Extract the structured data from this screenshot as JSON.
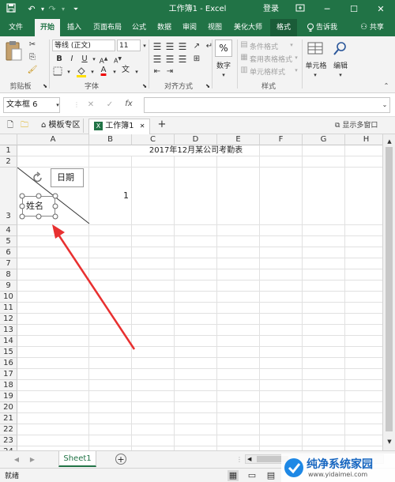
{
  "window": {
    "title": "工作簿1 - Excel",
    "login": "登录"
  },
  "tabs": [
    "文件",
    "开始",
    "插入",
    "页面布局",
    "公式",
    "数据",
    "审阅",
    "视图",
    "美化大师",
    "格式"
  ],
  "tell_me": "告诉我",
  "share": "共享",
  "ribbon": {
    "clipboard_label": "剪贴板",
    "font_label": "字体",
    "align_label": "对齐方式",
    "styles_label": "样式",
    "font_name": "等线 (正文)",
    "font_size": "11",
    "number_label": "数字",
    "percent": "%",
    "cond_format": "条件格式",
    "table_format": "套用表格格式",
    "cell_styles": "单元格样式",
    "cells": "单元格",
    "editing": "编辑",
    "bold": "B",
    "italic": "I",
    "underline": "U",
    "font_color_letter": "A",
    "wen": "文"
  },
  "formula_bar": {
    "name_box": "文本框 6",
    "fx": "fx",
    "cancel": "✕",
    "confirm": "✓",
    "value": ""
  },
  "workbook_tabs": {
    "tab1": "模板专区",
    "tab2": "工作簿1",
    "add": "+",
    "show_multi": "显示多窗口"
  },
  "grid": {
    "columns": [
      "A",
      "B",
      "C",
      "D",
      "E",
      "F",
      "G",
      "H"
    ],
    "rows": [
      "1",
      "2",
      "3",
      "4",
      "5",
      "6",
      "7",
      "8",
      "9",
      "10",
      "11",
      "12",
      "13",
      "14",
      "15",
      "16",
      "17",
      "18",
      "19",
      "20",
      "21",
      "22",
      "23",
      "24"
    ],
    "title_text": "2017年12月某公司考勤表",
    "date_label": "日期",
    "name_label": "姓名",
    "b3_value": "1"
  },
  "sheet_tabs": {
    "sheet1": "Sheet1",
    "add": "+"
  },
  "status": {
    "ready": "就绪"
  },
  "watermark": {
    "text": "纯净系统家园",
    "url": "www.yidaimei.com"
  },
  "colors": {
    "excel_green": "#217346",
    "arrow_red": "#e83030"
  }
}
